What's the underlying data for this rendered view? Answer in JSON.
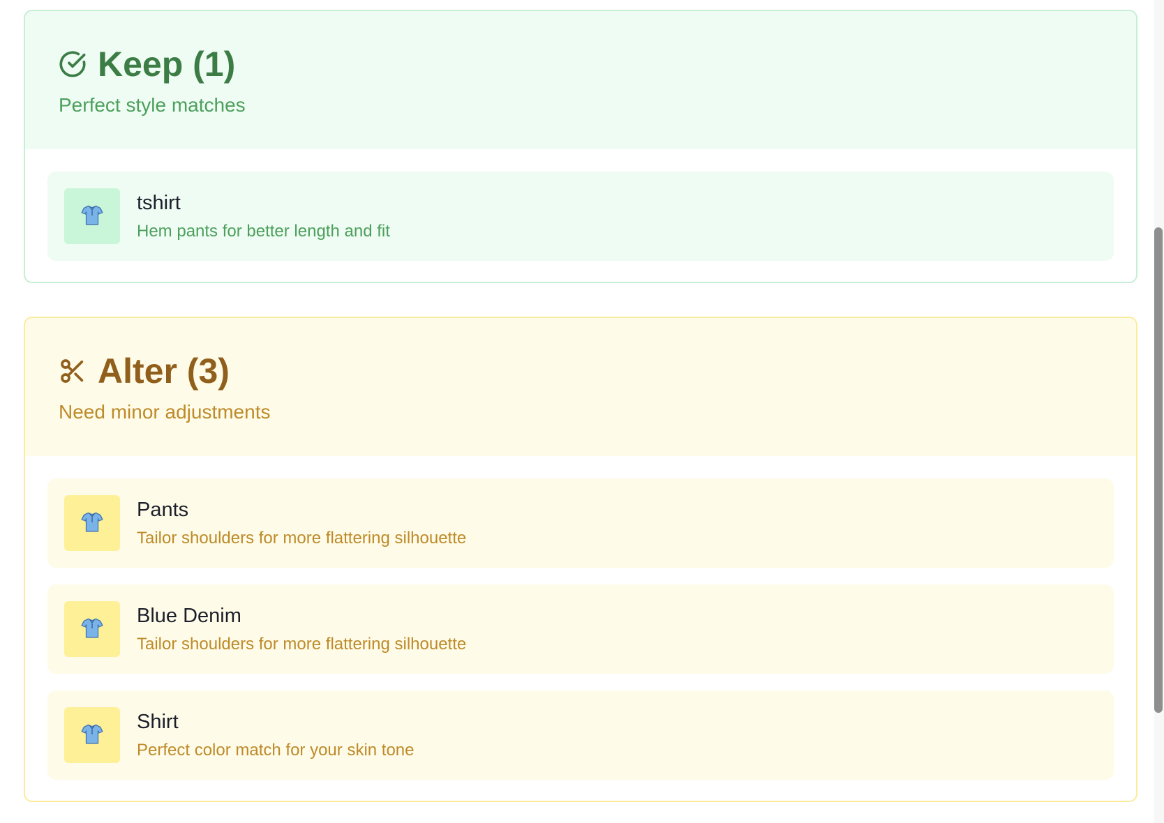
{
  "keep": {
    "title": "Keep (1)",
    "subtitle": "Perfect style matches",
    "icon": "check-circle-icon",
    "color": "#3c7c45",
    "items": [
      {
        "name": "tshirt",
        "description": "Hem pants for better length and fit",
        "icon": "tshirt-icon"
      }
    ]
  },
  "alter": {
    "title": "Alter (3)",
    "subtitle": "Need minor adjustments",
    "icon": "scissors-icon",
    "color": "#915f1c",
    "items": [
      {
        "name": "Pants",
        "description": "Tailor shoulders for more flattering silhouette",
        "icon": "tshirt-icon"
      },
      {
        "name": "Blue Denim",
        "description": "Tailor shoulders for more flattering silhouette",
        "icon": "tshirt-icon"
      },
      {
        "name": "Shirt",
        "description": "Perfect color match for your skin tone",
        "icon": "tshirt-icon"
      }
    ]
  }
}
